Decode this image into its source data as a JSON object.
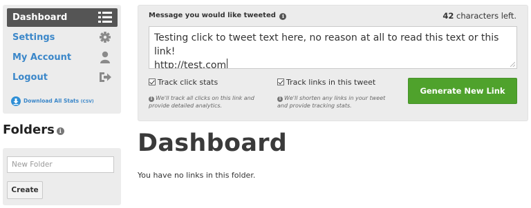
{
  "sidebar": {
    "items": [
      {
        "label": "Dashboard",
        "icon": "list-icon",
        "active": true
      },
      {
        "label": "Settings",
        "icon": "gear-icon"
      },
      {
        "label": "My Account",
        "icon": "user-icon"
      },
      {
        "label": "Logout",
        "icon": "logout-icon"
      }
    ],
    "download": {
      "label": "Download All Stats",
      "suffix": "(CSV)",
      "icon": "download-icon"
    }
  },
  "folders": {
    "title": "Folders",
    "input_placeholder": "New Folder",
    "create_label": "Create"
  },
  "tweet": {
    "label": "Message you would like tweeted",
    "chars_count": "42",
    "chars_suffix": "characters left.",
    "text_line1": "Testing click to tweet text here, no reason at all to read this text or this link!",
    "text_line2": "http://test.com",
    "track_clicks_label": "Track click stats",
    "track_clicks_hint": "We'll track all clicks on this link and provide detailed analytics.",
    "track_links_label": "Track links in this tweet",
    "track_links_hint": "We'll shorten any links in your tweet and provide tracking stats.",
    "generate_label": "Generate New Link"
  },
  "main": {
    "title": "Dashboard",
    "empty_message": "You have no links in this folder."
  },
  "colors": {
    "link_blue": "#3b87c9",
    "active_nav": "#555555",
    "generate_green": "#4fa22c",
    "panel_gray": "#ececec"
  }
}
